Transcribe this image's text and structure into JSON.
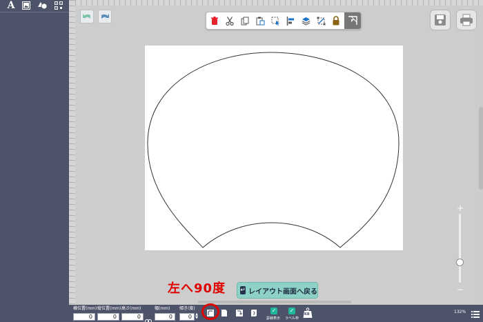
{
  "sidebar": {
    "tools": [
      {
        "name": "text-tool",
        "glyph": "A"
      },
      {
        "name": "image-tool",
        "glyph": ""
      },
      {
        "name": "shape-tool",
        "glyph": ""
      },
      {
        "name": "qr-tool",
        "glyph": ""
      }
    ]
  },
  "caption": "左へ90度",
  "back_button": {
    "label": "レイアウト画面へ戻る"
  },
  "fields": [
    {
      "name": "x-position",
      "label": "横位置(mm)",
      "value": "0"
    },
    {
      "name": "y-position",
      "label": "縦位置(mm)",
      "value": "0"
    },
    {
      "name": "height",
      "label": "高さ(mm)",
      "value": "0"
    },
    {
      "name": "width",
      "label": "幅(mm)",
      "value": "0"
    },
    {
      "name": "rotation",
      "label": "傾き(度)",
      "value": "0"
    }
  ],
  "checks": [
    {
      "name": "show-grid",
      "label": "罫線表示"
    },
    {
      "name": "label-frame",
      "label": "ラベル枠"
    }
  ],
  "kb_label": "KB",
  "zoom": {
    "level": "132%",
    "plus": "+",
    "minus": "−"
  },
  "colors": {
    "sidebar": "#4d5469",
    "accent_red": "#e00000",
    "back_button": "#8ed1c7",
    "check": "#20b89a"
  }
}
